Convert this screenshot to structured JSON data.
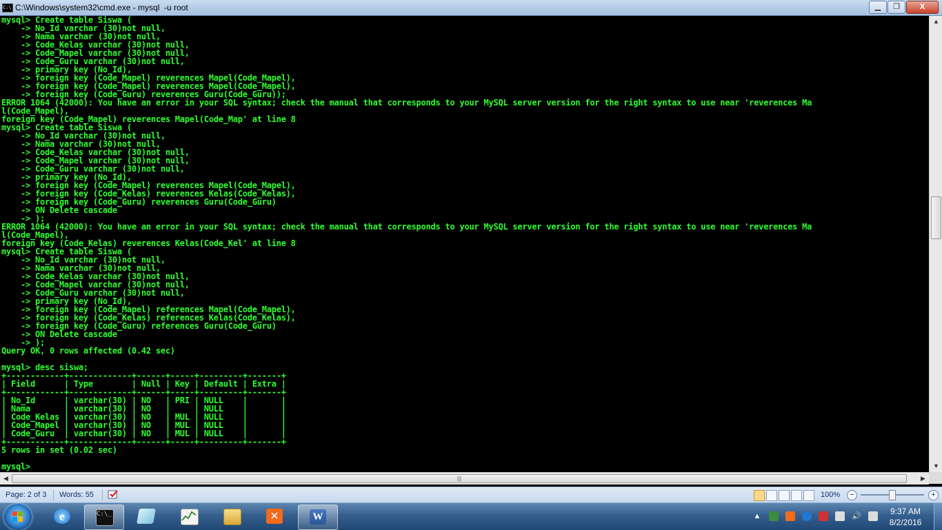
{
  "window": {
    "title": "C:\\Windows\\system32\\cmd.exe - mysql  -u root",
    "icon": "cmd-icon",
    "minimize": "▁",
    "maximize": "❐",
    "close": "X"
  },
  "console": {
    "lines": [
      "mysql> Create table Siswa (",
      "    -> No_Id varchar (30)not null,",
      "    -> Nama varchar (30)not null,",
      "    -> Code_Kelas varchar (30)not null,",
      "    -> Code_Mapel varchar (30)not null,",
      "    -> Code_Guru varchar (30)not null,",
      "    -> primary key (No_Id),",
      "    -> foreign key (Code_Mapel) reverences Mapel(Code_Mapel),",
      "    -> foreign key (Code_Mapel) reverences Mapel(Code_Mapel),",
      "    -> foreign key (Code_Guru) reverences Guru(Code_Guru));",
      "ERROR 1064 (42000): You have an error in your SQL syntax; check the manual that corresponds to your MySQL server version for the right syntax to use near 'reverences Ma",
      "l(Code_Mapel),",
      "foreign key (Code_Mapel) reverences Mapel(Code_Map' at line 8",
      "mysql> Create table Siswa (",
      "    -> No_Id varchar (30)not null,",
      "    -> Nama varchar (30)not null,",
      "    -> Code_Kelas varchar (30)not null,",
      "    -> Code_Mapel varchar (30)not null,",
      "    -> Code_Guru varchar (30)not null,",
      "    -> primary key (No_Id),",
      "    -> foreign key (Code_Mapel) reverences Mapel(Code_Mapel),",
      "    -> foreign key (Code_Kelas) reverences Kelas(Code_Kelas),",
      "    -> foreign key (Code_Guru) reverences Guru(Code_Guru)",
      "    -> ON Delete cascade",
      "    -> );",
      "ERROR 1064 (42000): You have an error in your SQL syntax; check the manual that corresponds to your MySQL server version for the right syntax to use near 'reverences Ma",
      "l(Code_Mapel),",
      "foreign key (Code_Kelas) reverences Kelas(Code_Kel' at line 8",
      "mysql> Create table Siswa (",
      "    -> No_Id varchar (30)not null,",
      "    -> Nama varchar (30)not null,",
      "    -> Code_Kelas varchar (30)not null,",
      "    -> Code_Mapel varchar (30)not null,",
      "    -> Code_Guru varchar (30)not null,",
      "    -> primary key (No_Id),",
      "    -> foreign key (Code_Mapel) references Mapel(Code_Mapel),",
      "    -> foreign key (Code_Kelas) references Kelas(Code_Kelas),",
      "    -> foreign key (Code_Guru) references Guru(Code_Guru)",
      "    -> ON Delete cascade",
      "    -> );",
      "Query OK, 0 rows affected (0.42 sec)",
      "",
      "mysql> desc siswa;",
      "+------------+-------------+------+-----+---------+-------+",
      "| Field      | Type        | Null | Key | Default | Extra |",
      "+------------+-------------+------+-----+---------+-------+",
      "| No_Id      | varchar(30) | NO   | PRI | NULL    |       |",
      "| Nama       | varchar(30) | NO   |     | NULL    |       |",
      "| Code_Kelas | varchar(30) | NO   | MUL | NULL    |       |",
      "| Code_Mapel | varchar(30) | NO   | MUL | NULL    |       |",
      "| Code_Guru  | varchar(30) | NO   | MUL | NULL    |       |",
      "+------------+-------------+------+-----+---------+-------+",
      "5 rows in set (0.02 sec)",
      "",
      "mysql>"
    ],
    "text_color": "#2eff2e"
  },
  "scrollbars": {
    "up": "▲",
    "down": "▼",
    "left": "◀",
    "right": "▶",
    "grip": "|||"
  },
  "word_status": {
    "page": "Page: 2 of 3",
    "words": "Words: 55",
    "zoom": "100%",
    "zoom_minus": "−",
    "zoom_plus": "+"
  },
  "taskbar": {
    "time": "9:37 AM",
    "date": "8/2/2016",
    "apps": [
      {
        "name": "internet-explorer-icon",
        "color": "#1e78d0"
      },
      {
        "name": "cmd-icon",
        "color": "#111111"
      },
      {
        "name": "notepad-icon",
        "color": "#9fd4e6"
      },
      {
        "name": "task-manager-icon",
        "color": "#3d8b3d"
      },
      {
        "name": "file-explorer-icon",
        "color": "#e8c45a"
      },
      {
        "name": "xampp-icon",
        "color": "#f26a1b"
      },
      {
        "name": "word-icon",
        "color": "#2b5797"
      }
    ],
    "tray": {
      "up": "▲",
      "volume": "🔊"
    }
  }
}
